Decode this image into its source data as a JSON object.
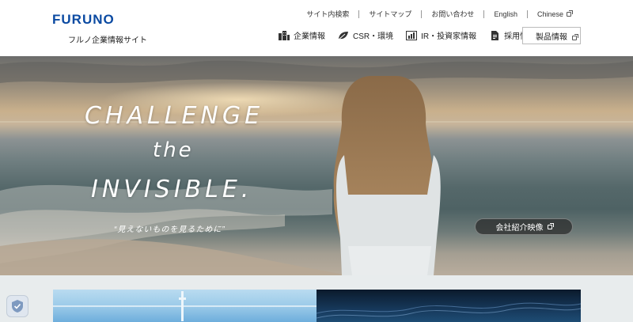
{
  "header": {
    "logo_text": "FURUNO",
    "site_name": "フルノ企業情報サイト",
    "util_nav": [
      {
        "label": "サイト内検索"
      },
      {
        "label": "サイトマップ"
      },
      {
        "label": "お問い合わせ"
      },
      {
        "label": "English"
      },
      {
        "label": "Chinese"
      }
    ],
    "main_nav": [
      {
        "label": "企業情報",
        "icon": "building-icon"
      },
      {
        "label": "CSR・環境",
        "icon": "leaf-icon"
      },
      {
        "label": "IR・投資家情報",
        "icon": "chart-icon"
      },
      {
        "label": "採用情報",
        "icon": "document-icon"
      }
    ],
    "product_button": "製品情報"
  },
  "hero": {
    "title_line1": "CHALLENGE",
    "title_line2": "the",
    "title_line3": "INVISIBLE.",
    "caption": "“見えないものを見るために”",
    "video_button": "会社紹介映像"
  },
  "colors": {
    "brand": "#0b4aa2",
    "hero_sky": "#c9b08c",
    "hero_sea": "#55686a",
    "lower_bg": "#e8eced"
  }
}
